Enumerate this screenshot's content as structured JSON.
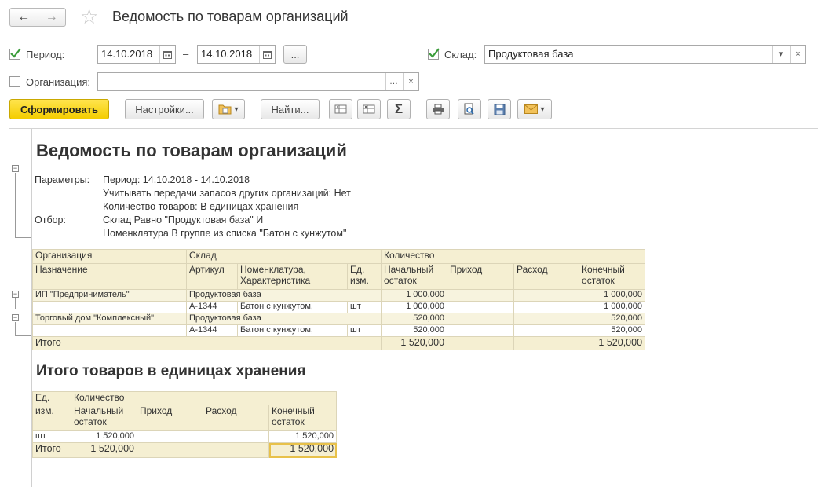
{
  "window": {
    "title": "Ведомость по товарам организаций"
  },
  "nav": {
    "back_icon": "←",
    "forward_icon": "→",
    "star_icon": "☆"
  },
  "form": {
    "period_label": "Период:",
    "date_from": "14.10.2018",
    "dash": "–",
    "date_to": "14.10.2018",
    "ellipsis": "...",
    "sklad_label": "Склад:",
    "sklad_value": "Продуктовая база",
    "org_label": "Организация:",
    "org_value": "",
    "dropdown_icon": "▾",
    "clear_icon": "×"
  },
  "toolbar": {
    "generate": "Сформировать",
    "settings": "Настройки...",
    "find": "Найти...",
    "sigma": "Σ",
    "dropdown_icon": "▾"
  },
  "report": {
    "title": "Ведомость по товарам организаций",
    "params_label": "Параметры:",
    "params": [
      "Период: 14.10.2018 - 14.10.2018",
      "Учитывать передачи запасов других организаций: Нет",
      "Количество товаров: В единицах хранения"
    ],
    "filter_label": "Отбор:",
    "filters": [
      "Склад Равно \"Продуктовая база\" И",
      "Номенклатура В группе из списка \"Батон с кунжутом\""
    ],
    "main_table": {
      "h1": {
        "org": "Организация",
        "sklad": "Склад",
        "qty": "Количество"
      },
      "h2": {
        "purpose": "Назначение",
        "article": "Артикул",
        "nomen1": "Номенклатура,",
        "nomen2": "Характеристика",
        "unit1": "Ед.",
        "unit2": "изм.",
        "start1": "Начальный",
        "start2": "остаток",
        "income": "Приход",
        "expense": "Расход",
        "end1": "Конечный",
        "end2": "остаток"
      },
      "rows": [
        {
          "org": "ИП \"Предприниматель\"",
          "sklad": "Продуктовая база",
          "start": "1 000,000",
          "end": "1 000,000",
          "detail": {
            "article": "А-1344",
            "nomen": "Батон с кунжутом,",
            "unit": "шт",
            "start": "1 000,000",
            "end": "1 000,000"
          }
        },
        {
          "org": "Торговый дом \"Комплексный\"",
          "sklad": "Продуктовая база",
          "start": "520,000",
          "end": "520,000",
          "detail": {
            "article": "А-1344",
            "nomen": "Батон с кунжутом,",
            "unit": "шт",
            "start": "520,000",
            "end": "520,000"
          }
        }
      ],
      "total": {
        "label": "Итого",
        "start": "1 520,000",
        "end": "1 520,000"
      }
    },
    "subtitle": "Итого товаров в единицах хранения",
    "units_table": {
      "h1": {
        "unit1": "Ед.",
        "qty": "Количество"
      },
      "h2": {
        "unit2": "изм.",
        "start1": "Начальный",
        "start2": "остаток",
        "income": "Приход",
        "expense": "Расход",
        "end1": "Конечный",
        "end2": "остаток"
      },
      "row": {
        "unit": "шт",
        "start": "1 520,000",
        "end": "1 520,000"
      },
      "total": {
        "label": "Итого",
        "start": "1 520,000",
        "end": "1 520,000"
      }
    }
  },
  "colors": {
    "accent_yellow": "#f4cd00",
    "check_green": "#3a9c3a",
    "table_header": "#f5efd2",
    "table_border": "#dcd5b8"
  }
}
